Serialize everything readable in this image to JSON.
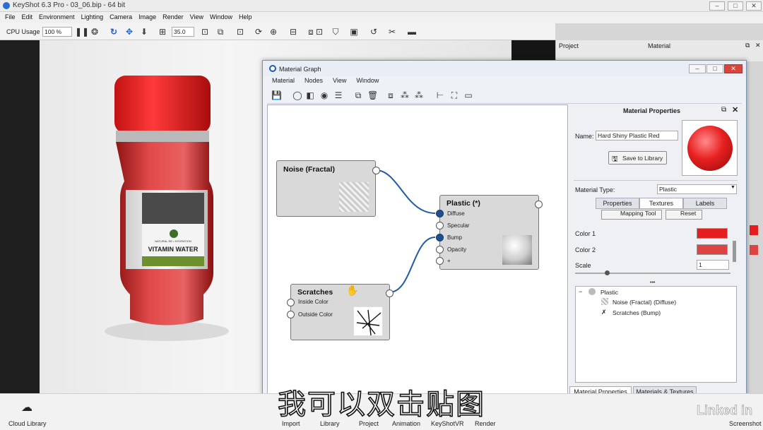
{
  "app": {
    "title": "KeyShot 6.3 Pro - 03_06.bip - 64 bit"
  },
  "menu": [
    "File",
    "Edit",
    "Environment",
    "Lighting",
    "Camera",
    "Image",
    "Render",
    "View",
    "Window",
    "Help"
  ],
  "toolbar": {
    "cpu_label": "CPU Usage",
    "cpu_value": "100 %",
    "focal_value": "35.0"
  },
  "right_panel": {
    "project_label": "Project",
    "material_label": "Material"
  },
  "material_graph": {
    "title": "Material Graph",
    "menu": [
      "Material",
      "Nodes",
      "View",
      "Window"
    ],
    "nodes": {
      "noise": {
        "title": "Noise (Fractal)"
      },
      "plastic": {
        "title": "Plastic (*)",
        "ports": [
          "Diffuse",
          "Specular",
          "Bump",
          "Opacity",
          "+"
        ]
      },
      "scratches": {
        "title": "Scratches",
        "ports": [
          "Inside Color",
          "Outside Color"
        ]
      }
    }
  },
  "properties": {
    "header": "Material Properties",
    "name_label": "Name:",
    "name_value": "Hard Shiny Plastic Red",
    "save_label": "Save to Library",
    "type_label": "Material Type:",
    "type_value": "Plastic",
    "tabs": [
      "Properties",
      "Textures",
      "Labels"
    ],
    "mapping_tool": "Mapping Tool",
    "reset": "Reset",
    "color1_label": "Color 1",
    "color1": "#e41e1e",
    "color2_label": "Color 2",
    "color2": "#dc4444",
    "scale_label": "Scale",
    "scale_value": "1",
    "dots": "•••",
    "tree": [
      "Plastic",
      "Noise (Fractal) (Diffuse)",
      "Scratches (Bump)"
    ],
    "bottom_tabs": [
      "Material Properties",
      "Materials & Textures"
    ]
  },
  "bottom_bar": {
    "cloud_library": "Cloud Library",
    "items": [
      "Import",
      "Library",
      "Project",
      "Animation",
      "KeyShotVR",
      "Render"
    ],
    "screenshot": "Screenshot"
  },
  "label": {
    "line1": "NATURAL RE • HYDRATION",
    "line2": "VITAMIN WATER"
  },
  "subtitle": "我可以双击贴图",
  "watermark": "Linked in"
}
